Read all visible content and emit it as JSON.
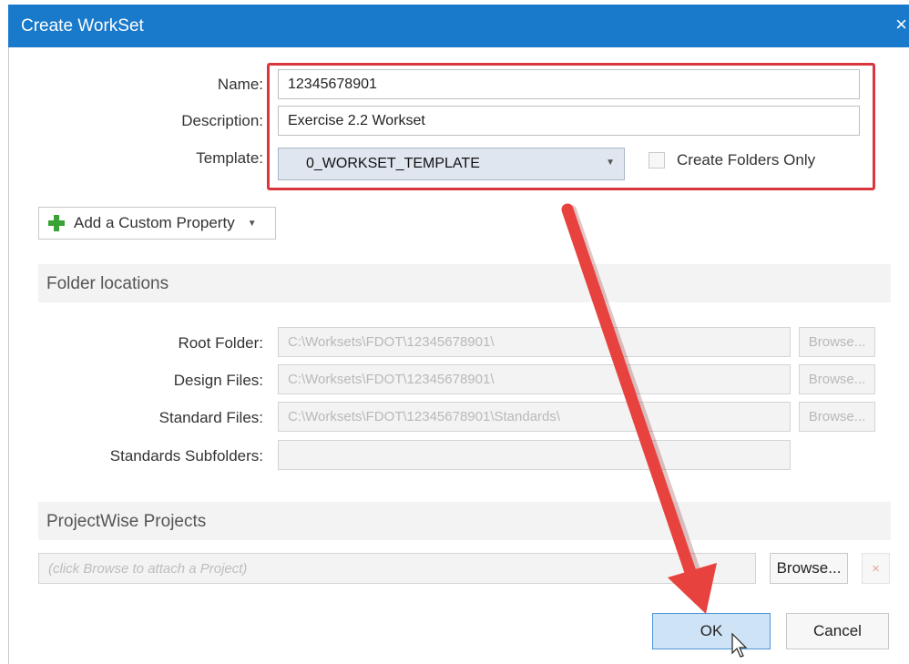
{
  "window": {
    "title": "Create WorkSet",
    "close_icon": "×"
  },
  "form": {
    "name_label": "Name:",
    "name_value": "12345678901",
    "description_label": "Description:",
    "description_value": "Exercise 2.2 Workset",
    "template_label": "Template:",
    "template_value": "0_WORKSET_TEMPLATE",
    "create_folders_only_label": "Create Folders Only",
    "create_folders_only_checked": false
  },
  "custom_property": {
    "label": "Add a Custom Property",
    "caret": "▼"
  },
  "folder_locations": {
    "title": "Folder locations",
    "rows": [
      {
        "label": "Root Folder:",
        "value": "C:\\Worksets\\FDOT\\12345678901\\",
        "browse": "Browse..."
      },
      {
        "label": "Design Files:",
        "value": "C:\\Worksets\\FDOT\\12345678901\\",
        "browse": "Browse..."
      },
      {
        "label": "Standard Files:",
        "value": "C:\\Worksets\\FDOT\\12345678901\\Standards\\",
        "browse": "Browse..."
      },
      {
        "label": "Standards Subfolders:",
        "value": ""
      }
    ]
  },
  "projectwise": {
    "title": "ProjectWise Projects",
    "placeholder": "(click Browse to attach a Project)",
    "browse_label": "Browse...",
    "remove_icon": "×"
  },
  "footer": {
    "ok_label": "OK",
    "cancel_label": "Cancel"
  },
  "colors": {
    "title_bar": "#1979ca",
    "highlight": "#d9363e",
    "arrow": "#e8423f",
    "ok_button": "#cfe3f7"
  }
}
